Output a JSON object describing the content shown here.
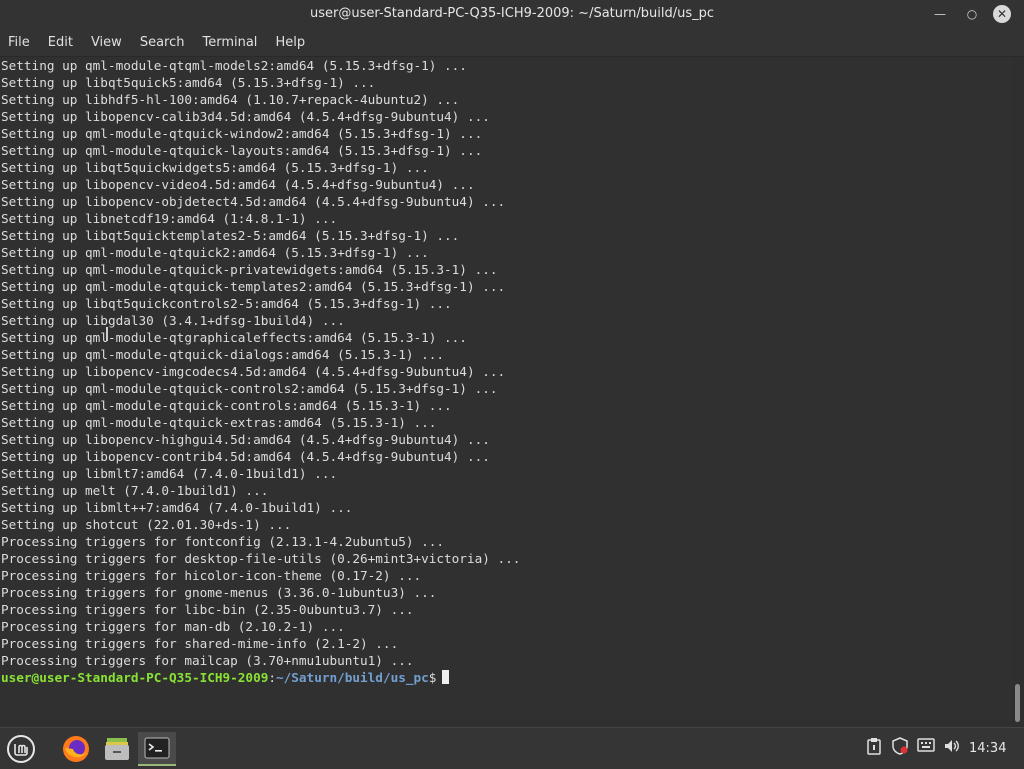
{
  "window": {
    "title": "user@user-Standard-PC-Q35-ICH9-2009: ~/Saturn/build/us_pc",
    "minimize_icon": "minimize-icon",
    "maximize_icon": "maximize-icon",
    "close_icon": "close-icon"
  },
  "menu": [
    "File",
    "Edit",
    "View",
    "Search",
    "Terminal",
    "Help"
  ],
  "terminal": {
    "lines": [
      "Setting up qml-module-qtqml-models2:amd64 (5.15.3+dfsg-1) ...",
      "Setting up libqt5quick5:amd64 (5.15.3+dfsg-1) ...",
      "Setting up libhdf5-hl-100:amd64 (1.10.7+repack-4ubuntu2) ...",
      "Setting up libopencv-calib3d4.5d:amd64 (4.5.4+dfsg-9ubuntu4) ...",
      "Setting up qml-module-qtquick-window2:amd64 (5.15.3+dfsg-1) ...",
      "Setting up qml-module-qtquick-layouts:amd64 (5.15.3+dfsg-1) ...",
      "Setting up libqt5quickwidgets5:amd64 (5.15.3+dfsg-1) ...",
      "Setting up libopencv-video4.5d:amd64 (4.5.4+dfsg-9ubuntu4) ...",
      "Setting up libopencv-objdetect4.5d:amd64 (4.5.4+dfsg-9ubuntu4) ...",
      "Setting up libnetcdf19:amd64 (1:4.8.1-1) ...",
      "Setting up libqt5quicktemplates2-5:amd64 (5.15.3+dfsg-1) ...",
      "Setting up qml-module-qtquick2:amd64 (5.15.3+dfsg-1) ...",
      "Setting up qml-module-qtquick-privatewidgets:amd64 (5.15.3-1) ...",
      "Setting up qml-module-qtquick-templates2:amd64 (5.15.3+dfsg-1) ...",
      "Setting up libqt5quickcontrols2-5:amd64 (5.15.3+dfsg-1) ...",
      "Setting up libgdal30 (3.4.1+dfsg-1build4) ...",
      "Setting up qml-module-qtgraphicaleffects:amd64 (5.15.3-1) ...",
      "Setting up qml-module-qtquick-dialogs:amd64 (5.15.3-1) ...",
      "Setting up libopencv-imgcodecs4.5d:amd64 (4.5.4+dfsg-9ubuntu4) ...",
      "Setting up qml-module-qtquick-controls2:amd64 (5.15.3+dfsg-1) ...",
      "Setting up qml-module-qtquick-controls:amd64 (5.15.3-1) ...",
      "Setting up qml-module-qtquick-extras:amd64 (5.15.3-1) ...",
      "Setting up libopencv-highgui4.5d:amd64 (4.5.4+dfsg-9ubuntu4) ...",
      "Setting up libopencv-contrib4.5d:amd64 (4.5.4+dfsg-9ubuntu4) ...",
      "Setting up libmlt7:amd64 (7.4.0-1build1) ...",
      "Setting up melt (7.4.0-1build1) ...",
      "Setting up libmlt++7:amd64 (7.4.0-1build1) ...",
      "Setting up shotcut (22.01.30+ds-1) ...",
      "Processing triggers for fontconfig (2.13.1-4.2ubuntu5) ...",
      "Processing triggers for desktop-file-utils (0.26+mint3+victoria) ...",
      "Processing triggers for hicolor-icon-theme (0.17-2) ...",
      "Processing triggers for gnome-menus (3.36.0-1ubuntu3) ...",
      "Processing triggers for libc-bin (2.35-0ubuntu3.7) ...",
      "Processing triggers for man-db (2.10.2-1) ...",
      "Processing triggers for shared-mime-info (2.1-2) ...",
      "Processing triggers for mailcap (3.70+nmu1ubuntu1) ..."
    ],
    "prompt_user": "user@user-Standard-PC-Q35-ICH9-2009",
    "prompt_sep": ":",
    "prompt_path": "~/Saturn/build/us_pc",
    "prompt_end": "$"
  },
  "taskbar": {
    "apps": [
      "mint-menu-icon",
      "firefox-icon",
      "files-icon",
      "terminal-icon"
    ],
    "tray": [
      "clipboard-icon",
      "shield-icon",
      "keyboard-icon",
      "volume-icon"
    ],
    "clock": "14:34"
  }
}
